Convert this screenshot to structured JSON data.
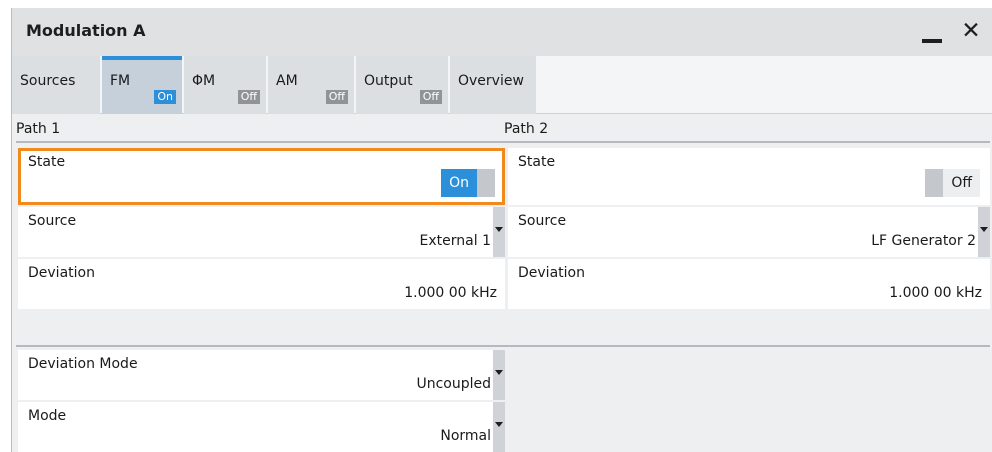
{
  "window": {
    "title": "Modulation A"
  },
  "tabs": [
    {
      "label": "Sources",
      "badge": ""
    },
    {
      "label": "FM",
      "badge": "On",
      "active": true
    },
    {
      "label": "ΦM",
      "badge": "Off"
    },
    {
      "label": "AM",
      "badge": "Off"
    },
    {
      "label": "Output",
      "badge": "Off"
    },
    {
      "label": "Overview",
      "badge": ""
    }
  ],
  "path1": {
    "header": "Path 1",
    "state": {
      "label": "State",
      "value": "On"
    },
    "source": {
      "label": "Source",
      "value": "External 1"
    },
    "deviation": {
      "label": "Deviation",
      "value": "1.000 00 kHz"
    }
  },
  "path2": {
    "header": "Path 2",
    "state": {
      "label": "State",
      "value": "Off"
    },
    "source": {
      "label": "Source",
      "value": "LF Generator 2"
    },
    "deviation": {
      "label": "Deviation",
      "value": "1.000 00 kHz"
    }
  },
  "common": {
    "deviation_mode": {
      "label": "Deviation Mode",
      "value": "Uncoupled"
    },
    "mode": {
      "label": "Mode",
      "value": "Normal"
    }
  },
  "colors": {
    "accent": "#2b90d9",
    "focus": "#f08a1c",
    "off_badge": "#909499"
  }
}
